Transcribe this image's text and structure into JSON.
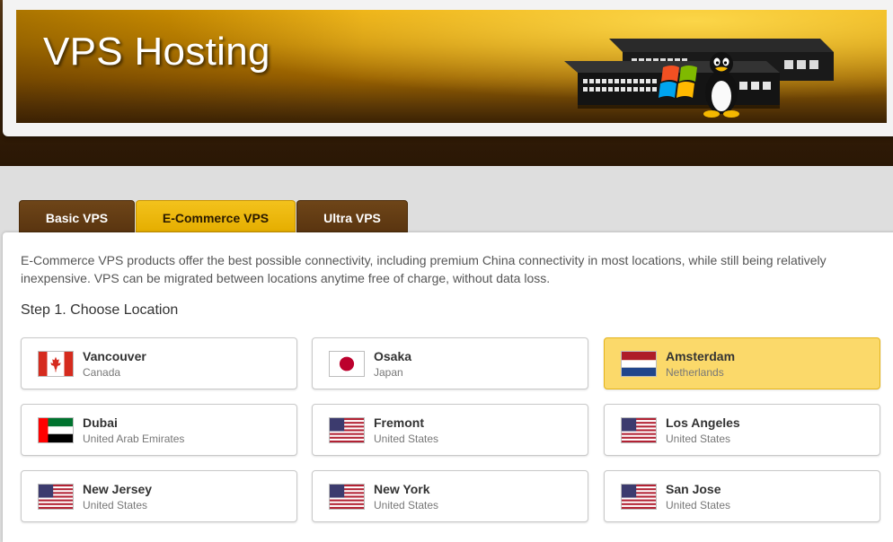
{
  "header": {
    "title": "VPS Hosting",
    "image": "server-switch-with-windows-and-linux-logos"
  },
  "tabs": [
    {
      "label": "Basic VPS",
      "active": false
    },
    {
      "label": "E-Commerce VPS",
      "active": true
    },
    {
      "label": "Ultra VPS",
      "active": false
    }
  ],
  "content": {
    "description": "E-Commerce VPS products offer the best possible connectivity, including premium China connectivity in most locations, while still being relatively inexpensive. VPS can be migrated between locations anytime free of charge, without data loss.",
    "step_title": "Step 1. Choose Location"
  },
  "locations": [
    {
      "city": "Vancouver",
      "country": "Canada",
      "flag": "canada-flag",
      "selected": false
    },
    {
      "city": "Osaka",
      "country": "Japan",
      "flag": "japan-flag",
      "selected": false
    },
    {
      "city": "Amsterdam",
      "country": "Netherlands",
      "flag": "netherlands-flag",
      "selected": true
    },
    {
      "city": "Dubai",
      "country": "United Arab Emirates",
      "flag": "uae-flag",
      "selected": false
    },
    {
      "city": "Fremont",
      "country": "United States",
      "flag": "usa-flag",
      "selected": false
    },
    {
      "city": "Los Angeles",
      "country": "United States",
      "flag": "usa-flag",
      "selected": false
    },
    {
      "city": "New Jersey",
      "country": "United States",
      "flag": "usa-flag",
      "selected": false
    },
    {
      "city": "New York",
      "country": "United States",
      "flag": "usa-flag",
      "selected": false
    },
    {
      "city": "San Jose",
      "country": "United States",
      "flag": "usa-flag",
      "selected": false
    }
  ],
  "colors": {
    "tab_active": "#e5ae00",
    "tab_inactive": "#5a3510",
    "card_selected": "#fbd96a",
    "header_dark": "#3b2208"
  }
}
